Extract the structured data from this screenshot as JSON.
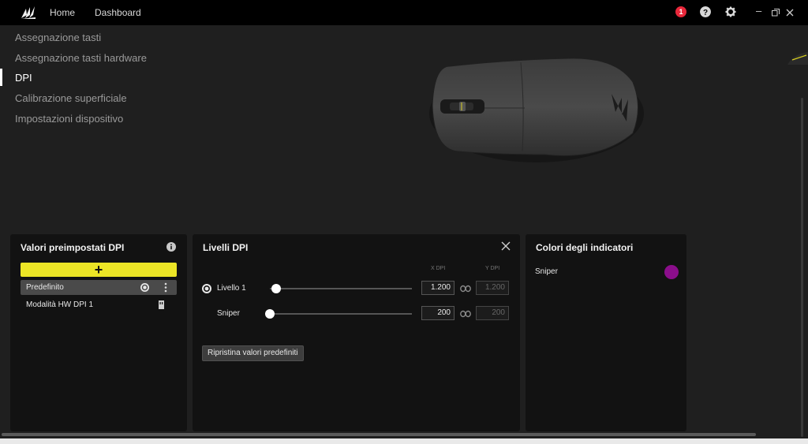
{
  "header": {
    "nav": [
      "Home",
      "Dashboard"
    ],
    "notification_count": "1",
    "icons": [
      "corsair-logo-icon",
      "help-icon",
      "gear-icon",
      "minimize-icon",
      "restore-icon",
      "close-icon"
    ]
  },
  "sidebar": {
    "items": [
      {
        "label": "Assegnazione tasti"
      },
      {
        "label": "Assegnazione tasti hardware"
      },
      {
        "label": "DPI"
      },
      {
        "label": "Calibrazione superficiale"
      },
      {
        "label": "Impostazioni dispositivo"
      }
    ],
    "active_index": 2
  },
  "presets_panel": {
    "title": "Valori preimpostati DPI",
    "add_label": "+",
    "items": [
      {
        "label": "Predefinito"
      },
      {
        "label": "Modalità HW DPI 1"
      }
    ]
  },
  "levels_panel": {
    "title": "Livelli DPI",
    "col_x": "X DPI",
    "col_y": "Y DPI",
    "levels": [
      {
        "label": "Livello 1",
        "x": "1.200",
        "y": "1.200",
        "slider_fraction": 0.047
      },
      {
        "label": "Sniper",
        "x": "200",
        "y": "200",
        "slider_fraction": 0.0
      }
    ],
    "reset_label": "Ripristina valori predefiniti"
  },
  "colors_panel": {
    "title": "Colori degli indicatori",
    "items": [
      {
        "label": "Sniper",
        "color": "#8b0e8b"
      }
    ]
  },
  "colors": {
    "accent": "#ece526",
    "notification": "#e8273a"
  }
}
